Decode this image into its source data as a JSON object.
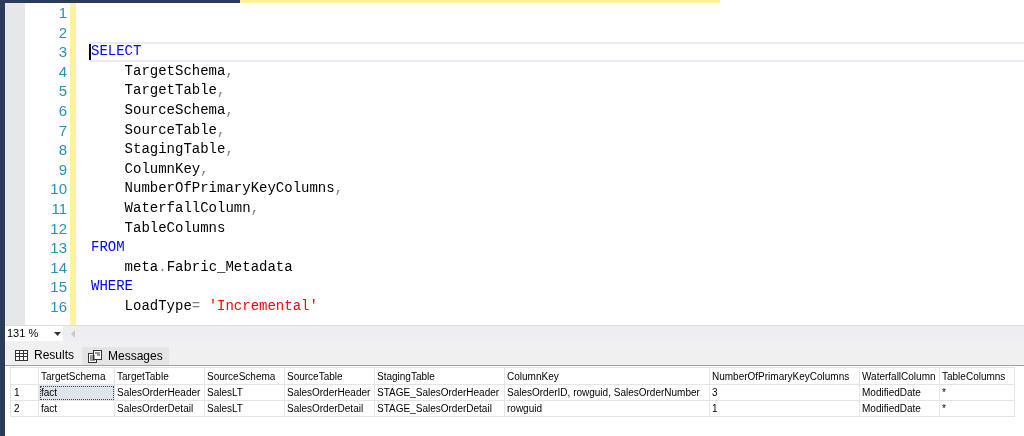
{
  "editor": {
    "lines": [
      {
        "number": "1",
        "current": false
      },
      {
        "number": "2",
        "current": false
      },
      {
        "number": "3",
        "current": true,
        "tokens": [
          {
            "kind": "keyword",
            "text": "SELECT"
          }
        ]
      },
      {
        "number": "4",
        "current": false,
        "tokens": [
          {
            "kind": "plain",
            "text": "    TargetSchema"
          },
          {
            "kind": "punct",
            "text": ","
          }
        ]
      },
      {
        "number": "5",
        "current": false,
        "tokens": [
          {
            "kind": "plain",
            "text": "    TargetTable"
          },
          {
            "kind": "punct",
            "text": ","
          }
        ]
      },
      {
        "number": "6",
        "current": false,
        "tokens": [
          {
            "kind": "plain",
            "text": "    SourceSchema"
          },
          {
            "kind": "punct",
            "text": ","
          }
        ]
      },
      {
        "number": "7",
        "current": false,
        "tokens": [
          {
            "kind": "plain",
            "text": "    SourceTable"
          },
          {
            "kind": "punct",
            "text": ","
          }
        ]
      },
      {
        "number": "8",
        "current": false,
        "tokens": [
          {
            "kind": "plain",
            "text": "    StagingTable"
          },
          {
            "kind": "punct",
            "text": ","
          }
        ]
      },
      {
        "number": "9",
        "current": false,
        "tokens": [
          {
            "kind": "plain",
            "text": "    ColumnKey"
          },
          {
            "kind": "punct",
            "text": ","
          }
        ]
      },
      {
        "number": "10",
        "current": false,
        "tokens": [
          {
            "kind": "plain",
            "text": "    NumberOfPrimaryKeyColumns"
          },
          {
            "kind": "punct",
            "text": ","
          }
        ]
      },
      {
        "number": "11",
        "current": false,
        "tokens": [
          {
            "kind": "plain",
            "text": "    WaterfallColumn"
          },
          {
            "kind": "punct",
            "text": ","
          }
        ]
      },
      {
        "number": "12",
        "current": false,
        "tokens": [
          {
            "kind": "plain",
            "text": "    TableColumns"
          }
        ]
      },
      {
        "number": "13",
        "current": false,
        "tokens": [
          {
            "kind": "keyword",
            "text": "FROM"
          }
        ]
      },
      {
        "number": "14",
        "current": false,
        "tokens": [
          {
            "kind": "plain",
            "text": "    meta"
          },
          {
            "kind": "punct",
            "text": "."
          },
          {
            "kind": "plain",
            "text": "Fabric_Metadata"
          }
        ]
      },
      {
        "number": "15",
        "current": false,
        "tokens": [
          {
            "kind": "keyword",
            "text": "WHERE"
          }
        ]
      },
      {
        "number": "16",
        "current": false,
        "tokens": [
          {
            "kind": "plain",
            "text": "    LoadType"
          },
          {
            "kind": "punct",
            "text": "= "
          },
          {
            "kind": "string",
            "text": "'Incremental'"
          }
        ]
      }
    ]
  },
  "zoom": {
    "value": "131 %"
  },
  "tabs": [
    {
      "label": "Results",
      "selected": true,
      "kind": "grid"
    },
    {
      "label": "Messages",
      "selected": false,
      "kind": "messages"
    }
  ],
  "table": {
    "columns": [
      "TargetSchema",
      "TargetTable",
      "SourceSchema",
      "SourceTable",
      "StagingTable",
      "ColumnKey",
      "NumberOfPrimaryKeyColumns",
      "WaterfallColumn",
      "TableColumns"
    ],
    "rows": [
      {
        "number": "1",
        "focused": true,
        "cells": [
          "fact",
          "SalesOrderHeader",
          "SalesLT",
          "SalesOrderHeader",
          "STAGE_SalesOrderHeader",
          "SalesOrderID, rowguid, SalesOrderNumber",
          "3",
          "ModifiedDate",
          "*"
        ]
      },
      {
        "number": "2",
        "focused": false,
        "cells": [
          "fact",
          "SalesOrderDetail",
          "SalesLT",
          "SalesOrderDetail",
          "STAGE_SalesOrderDetail",
          "rowguid",
          "1",
          "ModifiedDate",
          "*"
        ]
      }
    ]
  }
}
